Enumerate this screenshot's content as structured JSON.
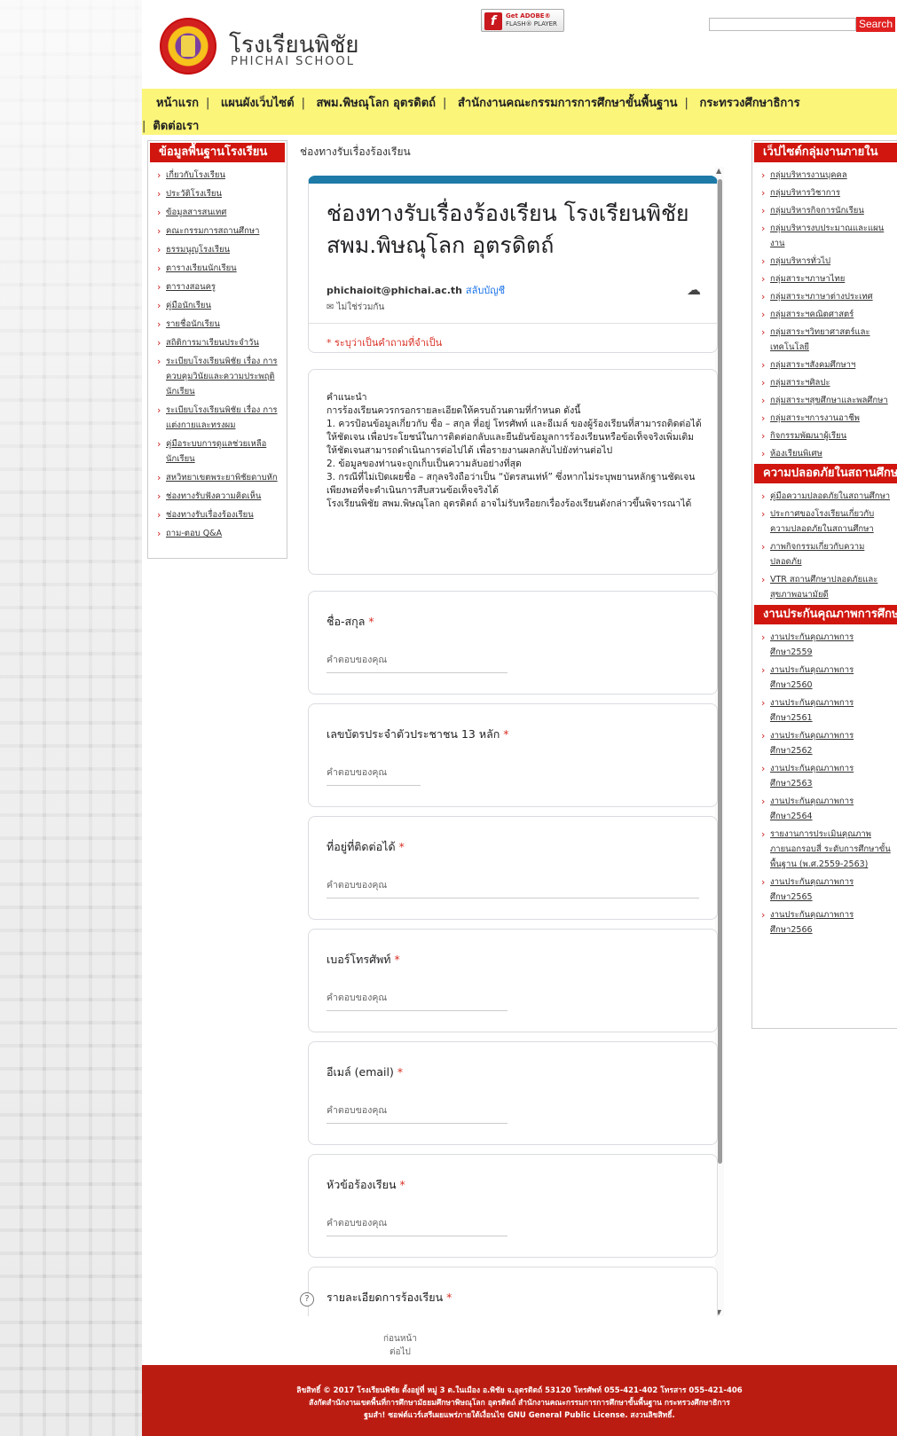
{
  "header": {
    "school_name_th": "โรงเรียนพิชัย",
    "school_name_en": "PHICHAI SCHOOL",
    "flash_badge_line1": "Get ADOBE®",
    "flash_badge_line2": "FLASH® PLAYER",
    "search_placeholder": "",
    "search_button": "Search"
  },
  "nav": {
    "items": [
      "หน้าแรก",
      "แผนผังเว็บไซต์",
      "สพม.พิษณุโลก อุตรดิตถ์",
      "สำนักงานคณะกรรมการการศึกษาขั้นพื้นฐาน",
      "กระทรวงศึกษาธิการ",
      "ติดต่อเรา"
    ]
  },
  "left_sidebar": {
    "title": "ข้อมูลพื้นฐานโรงเรียน",
    "items": [
      "เกี่ยวกับโรงเรียน",
      "ประวัติโรงเรียน",
      "ข้อมูลสารสนเทศ",
      "คณะกรรมการสถานศึกษา",
      "ธรรมนูญโรงเรียน",
      "ตารางเรียนนักเรียน",
      "ตารางสอนครู",
      "คู่มือนักเรียน",
      "รายชื่อนักเรียน",
      "สถิติการมาเรียนประจำวัน",
      "ระเบียบโรงเรียนพิชัย เรื่อง การควบคุมวินัยและความประพฤตินักเรียน",
      "ระเบียบโรงเรียนพิชัย เรื่อง การแต่งกายและทรงผม",
      "คู่มือระบบการดูแลช่วยเหลือนักเรียน",
      "สหวิทยาเขตพระยาพิชัยดาบหัก",
      "ช่องทางรับฟังความคิดเห็น",
      "ช่องทางรับเรื่องร้องเรียน",
      "ถาม-ตอบ Q&A"
    ]
  },
  "main": {
    "breadcrumb": "ช่องทางรับเรื่องร้องเรียน",
    "form_title": "ช่องทางรับเรื่องร้องเรียน โรงเรียนพิชัย สพม.พิษณุโลก อุตรดิตถ์",
    "account_email": "phichaioit@phichai.ac.th",
    "switch_account": "สลับบัญชี",
    "not_shared": "ไม่ใช่ร่วมกัน",
    "required_note": "* ระบุว่าเป็นคำถามที่จำเป็น",
    "note_text": "คำแนะนำ\nการร้องเรียนควรกรอกรายละเอียดให้ครบถ้วนตามที่กำหนด ดังนี้\n1. ควรป้อนข้อมูลเกี่ยวกับ ชื่อ – สกุล ที่อยู่ โทรศัพท์ และอีเมล์ ของผู้ร้องเรียนที่สามารถติดต่อได้ให้ชัดเจน เพื่อประโยชน์ในการติดต่อกลับและยืนยันข้อมูลการร้องเรียนหรือข้อเท็จจริงเพิ่มเติมให้ชัดเจนสามารถดำเนินการต่อไปได้ เพื่อรายงานผลกลับไปยังท่านต่อไป\n2. ข้อมูลของท่านจะถูกเก็บเป็นความลับอย่างที่สุด\n3. กรณีที่ไม่เปิดเผยชื่อ – สกุลจริงถือว่าเป็น “บัตรสนเท่ห์” ซึ่งหากไม่ระบุพยานหลักฐานชัดเจนเพียงพอที่จะดำเนินการสืบสวนข้อเท็จจริงได้\nโรงเรียนพิชัย สพม.พิษณุโลก อุตรดิตถ์ อาจไม่รับหรือยกเรื่องร้องเรียนดังกล่าวขึ้นพิจารณาได้",
    "answer_placeholder": "คำตอบของคุณ",
    "fields": [
      "ชื่อ-สกุล",
      "เลขบัตรประจำตัวประชาชน 13 หลัก",
      "ที่อยู่ที่ติดต่อได้",
      "เบอร์โทรศัพท์",
      "อีเมล์ (email)",
      "หัวข้อร้องเรียน",
      "รายละเอียดการร้องเรียน"
    ],
    "required_mark": "*",
    "help_icon": "?",
    "pager_prev": "ก่อนหน้า",
    "pager_next": "ต่อไป"
  },
  "right_sidebar": {
    "title1": "เว็ปไซต์กลุ่มงานภายใน",
    "items1": [
      "กลุ่มบริหารงานบุคคล",
      "กลุ่มบริหารวิชาการ",
      "กลุ่มบริหารกิจการนักเรียน",
      "กลุ่มบริหารงบประมาณและแผนงาน",
      "กลุ่มบริหารทั่วไป",
      "กลุ่มสาระฯภาษาไทย",
      "กลุ่มสาระฯภาษาต่างประเทศ",
      "กลุ่มสาระฯคณิตศาสตร์",
      "กลุ่มสาระฯวิทยาศาสตร์และเทคโนโลยี",
      "กลุ่มสาระฯสังคมศึกษาฯ",
      "กลุ่มสาระฯศิลปะ",
      "กลุ่มสาระฯสุขศึกษาและพลศึกษา",
      "กลุ่มสาระฯการงานอาชีพ",
      "กิจกรรมพัฒนาผู้เรียน",
      "ห้องเรียนพิเศษ"
    ],
    "title2": "ความปลอดภัยในสถานศึกษา",
    "items2": [
      "คู่มือความปลอดภัยในสถานศึกษา",
      "ประกาศของโรงเรียนเกี่ยวกับความปลอดภัยในสถานศึกษา",
      "ภาพกิจกรรมเกี่ยวกับความปลอดภัย",
      "VTR สถานศึกษาปลอดภัยและสุขภาพอนามัยดี"
    ],
    "title3": "งานประกันคุณภาพการศึกษา",
    "items3": [
      "งานประกันคุณภาพการศึกษา2559",
      "งานประกันคุณภาพการศึกษา2560",
      "งานประกันคุณภาพการศึกษา2561",
      "งานประกันคุณภาพการศึกษา2562",
      "งานประกันคุณภาพการศึกษา2563",
      "งานประกันคุณภาพการศึกษา2564",
      "รายงานการประเมินคุณภาพภายนอกรอบสี่ ระดับการศึกษาขั้นพื้นฐาน (พ.ศ.2559-2563)",
      "งานประกันคุณภาพการศึกษา2565",
      "งานประกันคุณภาพการศึกษา2566"
    ]
  },
  "footer": {
    "line1": "ลิขสิทธิ์ © 2017 โรงเรียนพิชัย ตั้งอยู่ที่ หมู่ 3 ต.ในเมือง อ.พิชัย จ.อุตรดิตถ์ 53120 โทรศัพท์ 055-421-402 โทรสาร 055-421-406",
    "line2": "สังกัดสำนักงานเขตพื้นที่การศึกษามัธยมศึกษาพิษณุโลก อุตรดิตถ์ สำนักงานคณะกรรมการการศึกษาขั้นพื้นฐาน กระทรวงศึกษาธิการ",
    "line3": "ฐมสำ! ซอฟต์แวร์เสรีเผยแพร่ภายใต้เงื่อนไข GNU General Public License. สงวนลิขสิทธิ์."
  }
}
